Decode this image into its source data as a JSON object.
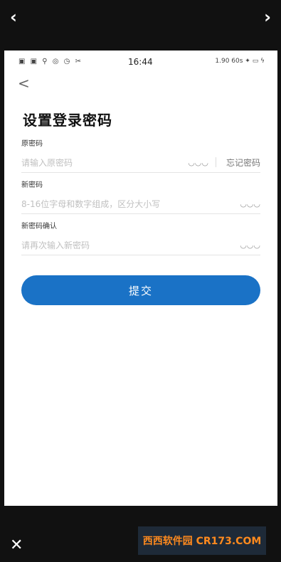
{
  "viewer": {
    "prev_icon": "‹",
    "next_icon": "›",
    "close_icon": "✕"
  },
  "status_bar": {
    "time": "16:44",
    "right_indicators": "1.90 60s  ✦ ▭ ϟ",
    "left_icons": "▣ ▣ ⚲ ◎ ◷ ✂"
  },
  "page": {
    "back_icon": "<",
    "title": "设置登录密码",
    "fields": [
      {
        "label": "原密码",
        "placeholder": "请输入原密码",
        "eye_icon": "◡◡◡",
        "forgot_label": "忘记密码"
      },
      {
        "label": "新密码",
        "placeholder": "8-16位字母和数字组成，区分大小写",
        "eye_icon": "◡◡◡"
      },
      {
        "label": "新密码确认",
        "placeholder": "请再次输入新密码",
        "eye_icon": "◡◡◡"
      }
    ],
    "submit_label": "提交"
  },
  "watermark": {
    "text": "西西软件园 CR173.COM"
  },
  "colors": {
    "accent": "#1a72c6",
    "background": "#111111"
  }
}
